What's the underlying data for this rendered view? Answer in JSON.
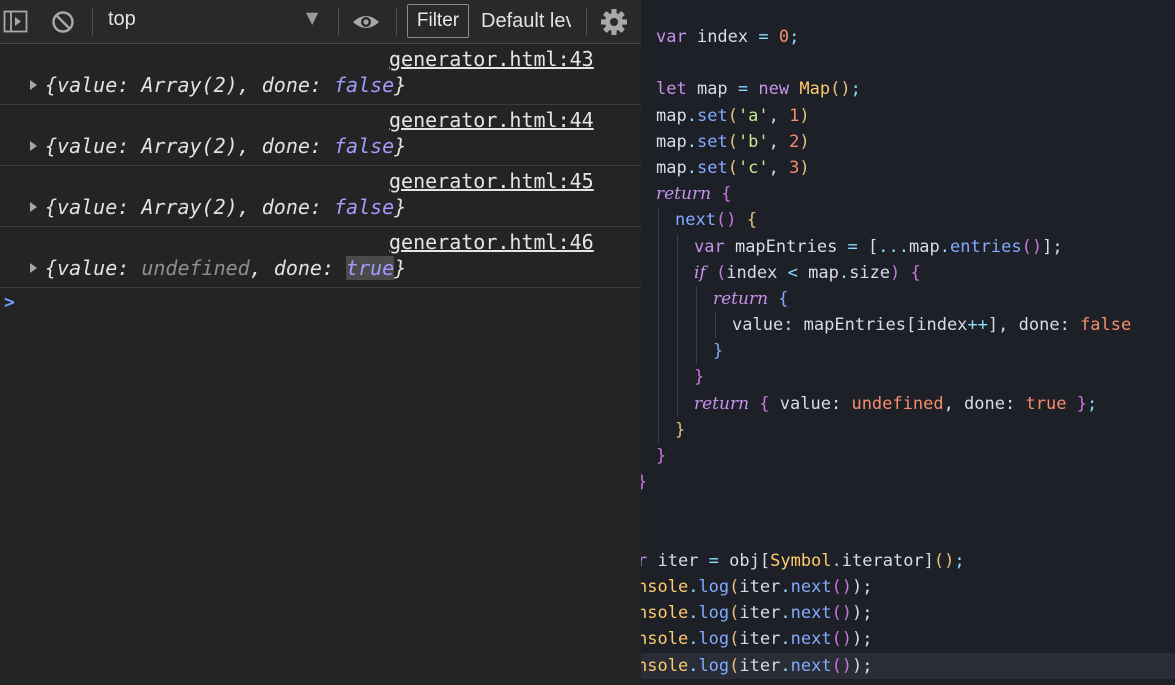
{
  "toolbar": {
    "context": "top",
    "filter_label": "Filter",
    "levels_label": "Default levels"
  },
  "console_entries": [
    {
      "source": "generator.html:43",
      "value": "Array(2)",
      "done": "false"
    },
    {
      "source": "generator.html:44",
      "value": "Array(2)",
      "done": "false"
    },
    {
      "source": "generator.html:45",
      "value": "Array(2)",
      "done": "false"
    },
    {
      "source": "generator.html:46",
      "value": "undefined",
      "done": "true"
    }
  ],
  "console_syntax": {
    "open": "{",
    "value_key": "value: ",
    "sep": ", ",
    "done_key": "done: ",
    "close": "}"
  },
  "prompt": ">",
  "code": {
    "l1": [
      "var",
      " index ",
      "=",
      " ",
      "0",
      ";"
    ],
    "l3": [
      "let",
      " map ",
      "=",
      " ",
      "new",
      " ",
      "Map",
      "()",
      ";"
    ],
    "l4": [
      "map",
      ".",
      "set",
      "(",
      "'a'",
      ", ",
      "1",
      ")"
    ],
    "l5": [
      "map",
      ".",
      "set",
      "(",
      "'b'",
      ", ",
      "2",
      ")"
    ],
    "l6": [
      "map",
      ".",
      "set",
      "(",
      "'c'",
      ", ",
      "3",
      ")"
    ],
    "l7": [
      "return",
      " ",
      "{"
    ],
    "l8": [
      "next",
      "()",
      " ",
      "{"
    ],
    "l9": [
      "var",
      " mapEntries ",
      "=",
      " [",
      "...",
      "map",
      ".",
      "entries",
      "()",
      "];"
    ],
    "l10": [
      "if",
      " (",
      "index ",
      "<",
      " map",
      ".",
      "size",
      ")",
      " ",
      "{"
    ],
    "l11": [
      "return",
      " ",
      "{"
    ],
    "l12": [
      "value",
      ": mapEntries[index",
      "++",
      "], ",
      "done",
      ": ",
      "false"
    ],
    "l13": [
      "}"
    ],
    "l14": [
      "}"
    ],
    "l15": [
      "return",
      " ",
      "{",
      " value",
      ": ",
      "undefined",
      ", done",
      ": ",
      "true",
      " ",
      "}",
      ";"
    ],
    "l16": [
      "}"
    ],
    "l17": [
      "}"
    ],
    "l18": [
      "}"
    ],
    "l21": [
      "r",
      " iter ",
      "=",
      " obj[",
      "Symbol",
      ".",
      "iterator",
      "]",
      "()",
      ";"
    ],
    "l22": [
      "nsole",
      ".",
      "log",
      "(",
      "iter",
      ".",
      "next",
      "()",
      ");"
    ],
    "l23": [
      "nsole",
      ".",
      "log",
      "(",
      "iter",
      ".",
      "next",
      "()",
      ");"
    ],
    "l24": [
      "nsole",
      ".",
      "log",
      "(",
      "iter",
      ".",
      "next",
      "()",
      ");"
    ],
    "l25": [
      "nsole",
      ".",
      "log",
      "(",
      "iter",
      ".",
      "next",
      "()",
      ");"
    ]
  },
  "colors": {
    "console_bg": "#242424",
    "editor_bg": "#1e2028",
    "keyword_bool": "#a29bfe",
    "link": "#e5e5e5",
    "prompt": "#6fa0ff"
  },
  "icons": [
    "sidebar-toggle-icon",
    "clear-console-icon",
    "dropdown-arrow-icon",
    "eye-icon",
    "gear-icon",
    "expand-triangle-icon"
  ]
}
